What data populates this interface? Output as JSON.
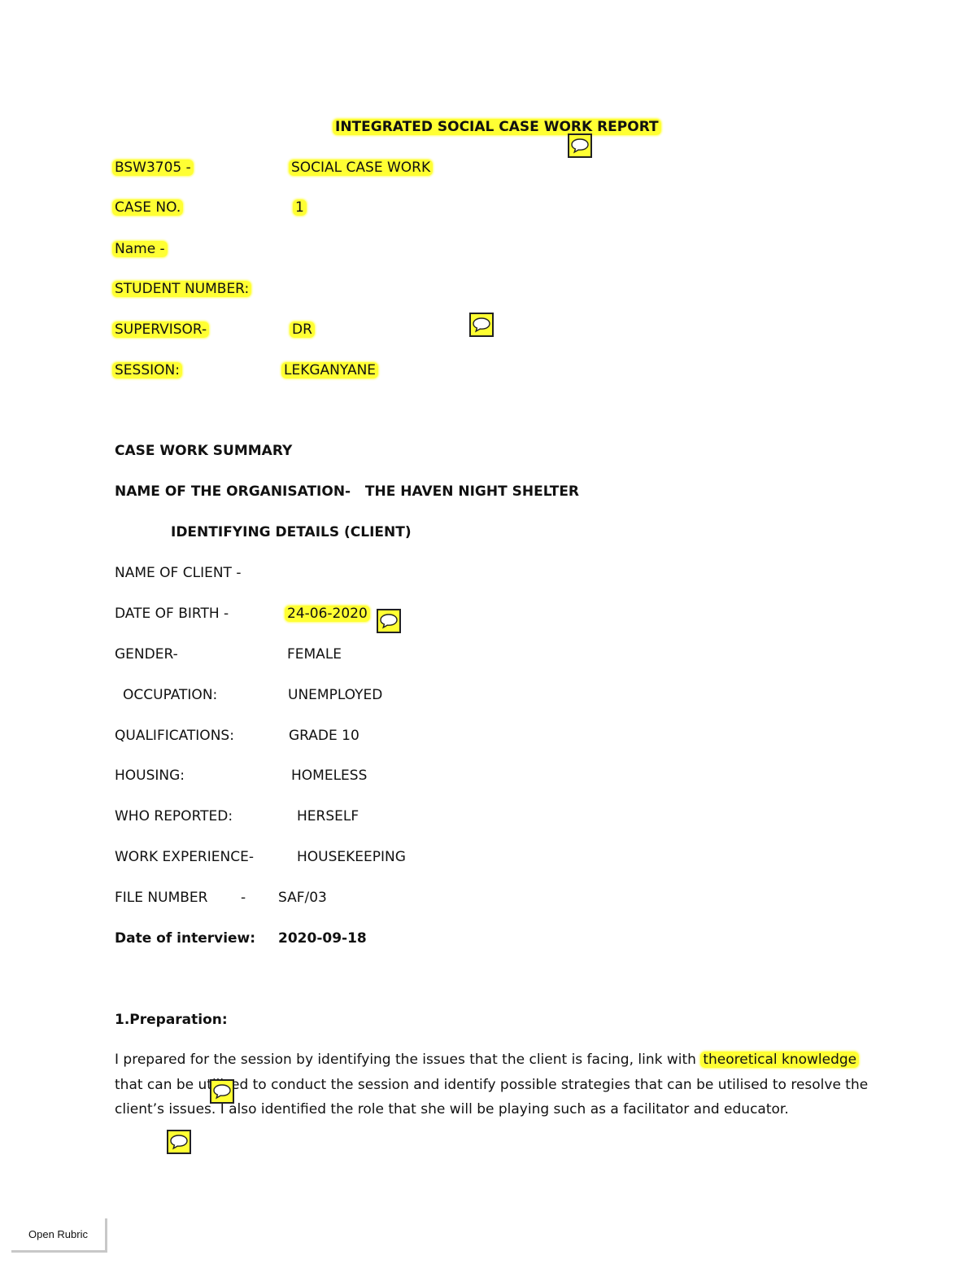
{
  "title": "INTEGRATED SOCIAL CASE WORK REPORT",
  "header_fields": [
    {
      "label": "BSW3705 -",
      "value": "SOCIAL CASE WORK"
    },
    {
      "label": "CASE NO.",
      "value": "1"
    },
    {
      "label": "Name -",
      "value": ""
    },
    {
      "label": "STUDENT NUMBER:",
      "value": ""
    },
    {
      "label": "SUPERVISOR-",
      "value": "DR"
    },
    {
      "label": "SESSION:",
      "value": "LEKGANYANE"
    }
  ],
  "summary_heading": "CASE WORK SUMMARY",
  "organisation_line": "NAME OF THE ORGANISATION-   THE HAVEN NIGHT SHELTER",
  "identifying_heading": "IDENTIFYING DETAILS (CLIENT)",
  "client_fields": [
    {
      "label": "NAME OF CLIENT -",
      "value": ""
    },
    {
      "label": "DATE OF BIRTH -",
      "value": "24-06-2020"
    },
    {
      "label": "GENDER-",
      "value": "FEMALE"
    },
    {
      "label": "OCCUPATION:",
      "value": "UNEMPLOYED"
    },
    {
      "label": "QUALIFICATIONS:",
      "value": "GRADE 10"
    },
    {
      "label": "HOUSING:",
      "value": "HOMELESS"
    },
    {
      "label": "WHO REPORTED:",
      "value": "HERSELF"
    },
    {
      "label": "WORK EXPERIENCE-",
      "value": "HOUSEKEEPING"
    },
    {
      "label": "FILE NUMBER",
      "value": "SAF/03",
      "separator": "-"
    },
    {
      "label": "Date of interview:",
      "value": "2020-09-18"
    }
  ],
  "preparation": {
    "heading": "1.Preparation:",
    "text_1": "I prepared for the session by identifying the issues that the client is facing, link with ",
    "highlight": "theoretical knowledge",
    "text_2": " that can be utilised to conduct the session and identify possible strategies that can be utilised to resolve the client’s issues. I also identified the role that she will be playing such as a facilitator and educator."
  },
  "comment_icon": "speech-bubble-icon",
  "highlight_color": "#ffff33",
  "open_rubric_label": "Open Rubric"
}
